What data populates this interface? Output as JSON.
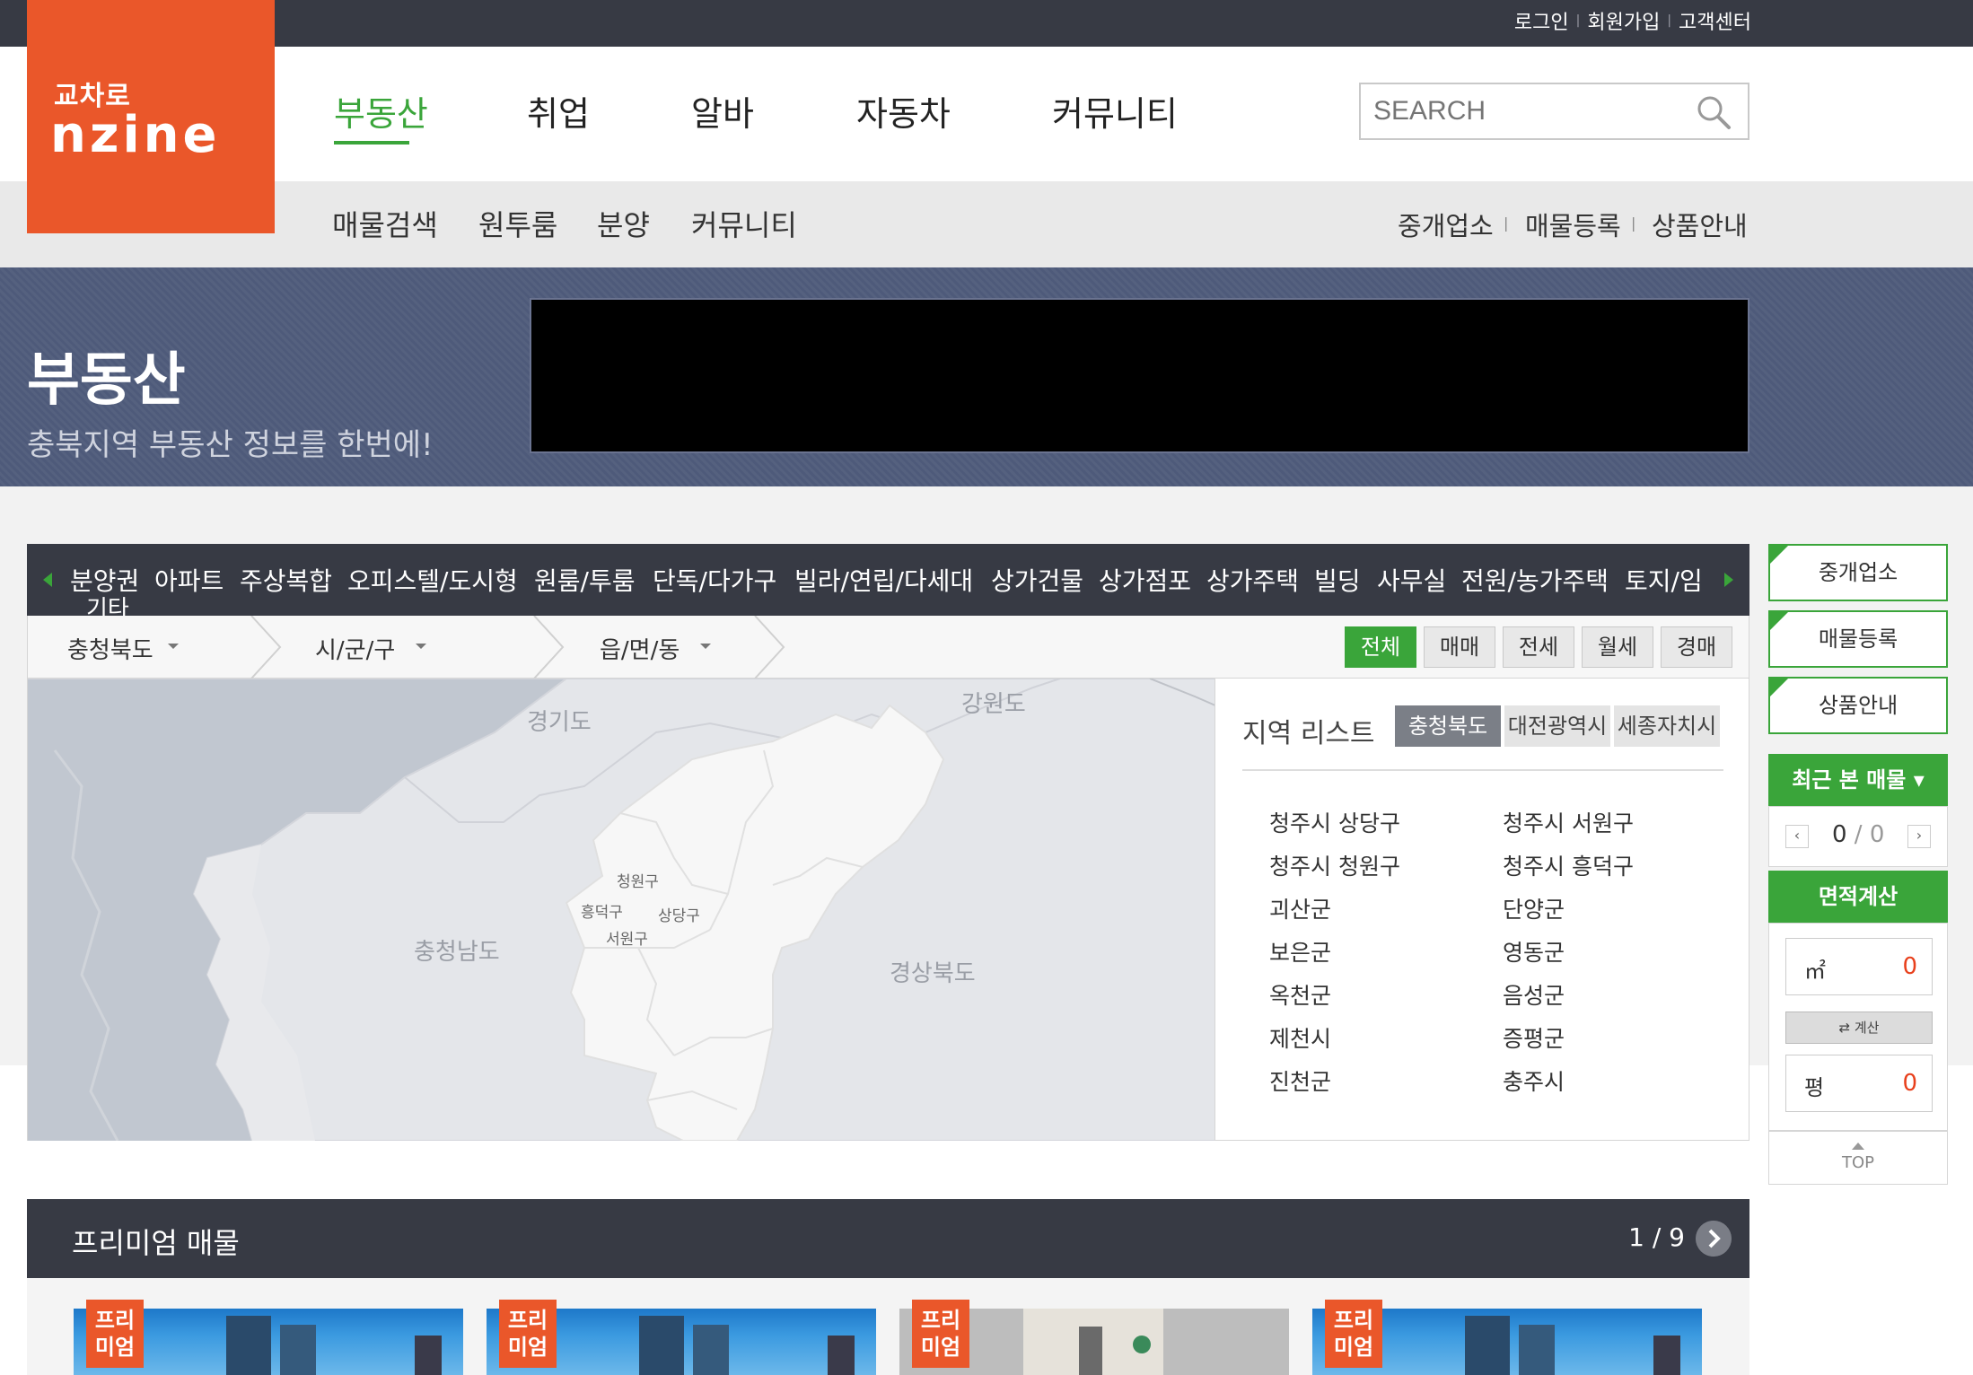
{
  "topbar": {
    "links": [
      "로그인",
      "회원가입",
      "고객센터"
    ]
  },
  "logo": {
    "small": "교차로",
    "big": "nzine"
  },
  "gnb": {
    "items": [
      "부동산",
      "취업",
      "알바",
      "자동차",
      "커뮤니티"
    ]
  },
  "search": {
    "placeholder": "SEARCH"
  },
  "subnav": {
    "left": [
      "매물검색",
      "원투룸",
      "분양",
      "커뮤니티"
    ],
    "right": [
      "중개업소",
      "매물등록",
      "상품안내"
    ]
  },
  "hero": {
    "title": "부동산",
    "subtitle": "충북지역 부동산 정보를 한번에!"
  },
  "categories": [
    "분양권",
    "아파트",
    "주상복합",
    "오피스텔/도시형",
    "원룸/투룸",
    "단독/다가구",
    "빌라/연립/다세대",
    "상가건물",
    "상가점포",
    "상가주택",
    "빌딩",
    "사무실",
    "전원/농가주택",
    "토지/임",
    "기타"
  ],
  "filters": {
    "province": "충청북도",
    "city": "시/군/구",
    "town": "읍/면/동",
    "deal_types": [
      "전체",
      "매매",
      "전세",
      "월세",
      "경매"
    ]
  },
  "map": {
    "labels": [
      "경기도",
      "강원도",
      "충청남도",
      "경상북도"
    ],
    "districts": [
      "청원구",
      "흥덕구",
      "상당구",
      "서원구"
    ]
  },
  "region": {
    "title": "지역 리스트",
    "tabs": [
      "충청북도",
      "대전광역시",
      "세종자치시"
    ],
    "items_left": [
      "청주시 상당구",
      "청주시 청원구",
      "괴산군",
      "보은군",
      "옥천군",
      "제천시",
      "진천군"
    ],
    "items_right": [
      "청주시 서원구",
      "청주시 흥덕구",
      "단양군",
      "영동군",
      "음성군",
      "증평군",
      "충주시"
    ]
  },
  "sidebar": {
    "buttons": [
      "중개업소",
      "매물등록",
      "상품안내"
    ],
    "recent_label": "최근 본 매물 ▾",
    "recent_current": "0",
    "recent_total": "0",
    "calc_label": "면적계산",
    "sqm_unit": "㎡",
    "sqm_value": "0",
    "calc_button": "⇄ 계산",
    "pyeong_unit": "평",
    "pyeong_value": "0",
    "top_label": "TOP"
  },
  "premium": {
    "title": "프리미엄 매물",
    "page": "1 / 9",
    "badge": [
      "프리",
      "미엄"
    ]
  },
  "colors": {
    "brand": "#ea572a",
    "accent": "#3aa53a",
    "dark": "#373a44",
    "hero": "#4e5a7a"
  }
}
